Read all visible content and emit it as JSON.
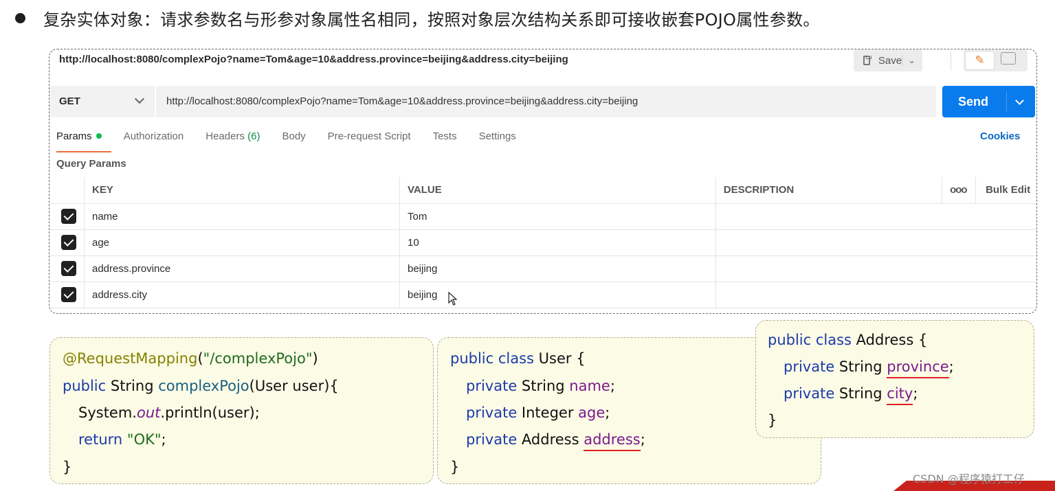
{
  "heading": "复杂实体对象：请求参数名与形参对象属性名相同，按照对象层次结构关系即可接收嵌套POJO属性参数。",
  "request": {
    "title_url": "http://localhost:8080/complexPojo?name=Tom&age=10&address.province=beijing&address.city=beijing",
    "save_label": "Save",
    "method": "GET",
    "url": "http://localhost:8080/complexPojo?name=Tom&age=10&address.province=beijing&address.city=beijing",
    "send_label": "Send"
  },
  "tabs": {
    "params": "Params",
    "authorization": "Authorization",
    "headers": "Headers",
    "headers_count": "(6)",
    "body": "Body",
    "prerequest": "Pre-request Script",
    "tests": "Tests",
    "settings": "Settings",
    "cookies": "Cookies"
  },
  "query_params_label": "Query Params",
  "table": {
    "headers": {
      "key": "KEY",
      "value": "VALUE",
      "description": "DESCRIPTION",
      "more": "ooo",
      "bulk_edit": "Bulk Edit"
    },
    "rows": [
      {
        "key": "name",
        "value": "Tom",
        "checked": true
      },
      {
        "key": "age",
        "value": "10",
        "checked": true
      },
      {
        "key": "address.province",
        "value": "beijing",
        "checked": true
      },
      {
        "key": "address.city",
        "value": "beijing",
        "checked": true
      }
    ]
  },
  "code_controller": {
    "annotation": "@RequestMapping",
    "paren_open": "(",
    "path": "\"/complexPojo\"",
    "paren_close": ")",
    "kw_public": "public",
    "type_string": " String ",
    "method_name": "complexPojo",
    "params": "(User user){",
    "system": "System.",
    "out": "out",
    "println": ".println(user);",
    "kw_return": "return",
    "ok": "\"OK\"",
    "semicolon": ";",
    "close": "}"
  },
  "code_user": {
    "kw_public_class": "public class",
    "class_decl": " User {",
    "kw_private": "private",
    "type_string": " String ",
    "type_integer": " Integer ",
    "type_address": " Address ",
    "f_name": "name",
    "f_age": "age",
    "f_address": "address",
    "semicolon": ";",
    "close": "}"
  },
  "code_address": {
    "kw_public_class": "public class",
    "class_decl": " Address {",
    "kw_private": "private",
    "type_string": " String ",
    "f_province": "province",
    "f_city": "city",
    "semicolon": ";",
    "close": "}"
  },
  "watermark": "CSDN @程序猿打工仔"
}
